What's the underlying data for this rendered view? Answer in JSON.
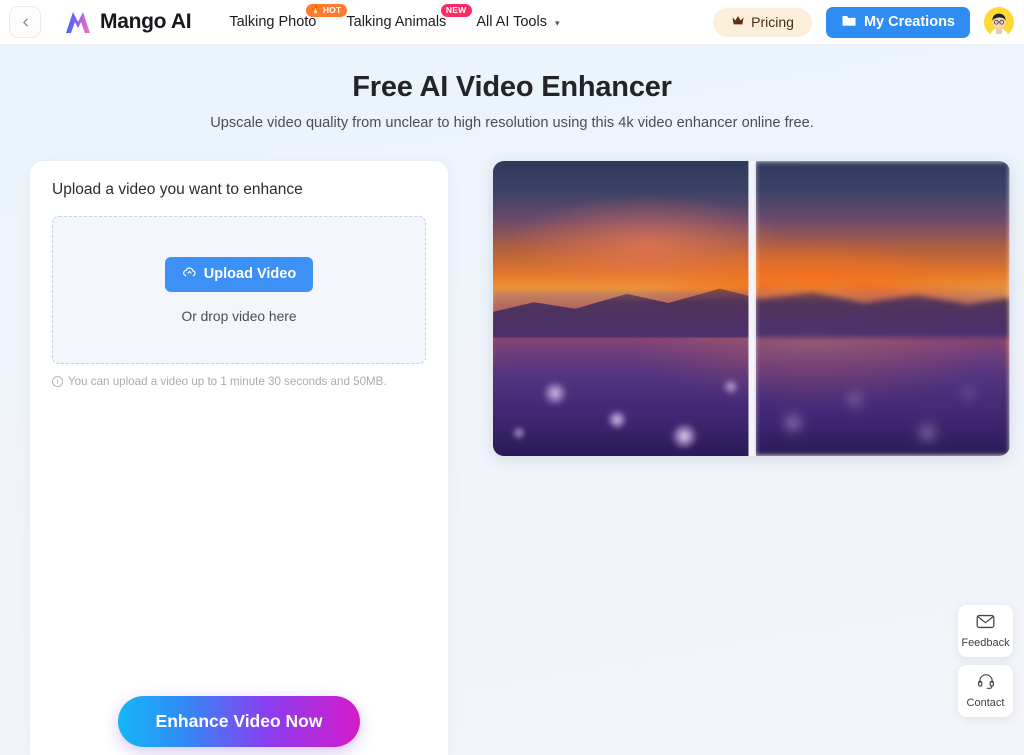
{
  "header": {
    "back_icon": "chevron-left-icon",
    "brand": {
      "logo_icon": "mango-ai-logo-icon",
      "name": "Mango AI"
    },
    "nav": [
      {
        "label": "Talking Photo",
        "badge": "HOT",
        "badge_type": "hot",
        "badge_icon": "flame-icon"
      },
      {
        "label": "Talking Animals",
        "badge": "NEW",
        "badge_type": "new"
      },
      {
        "label": "All AI Tools",
        "caret": "▾"
      }
    ],
    "pricing": {
      "label": "Pricing",
      "icon": "crown-icon"
    },
    "creations": {
      "label": "My Creations",
      "icon": "folder-icon"
    },
    "avatar_icon": "user-avatar"
  },
  "hero": {
    "title": "Free AI Video Enhancer",
    "subtitle": "Upscale video quality from unclear to high resolution using this 4k video enhancer online free."
  },
  "upload": {
    "card_title": "Upload a video you want to enhance",
    "button_label": "Upload Video",
    "button_icon": "cloud-upload-icon",
    "drop_text": "Or drop video here",
    "hint": "You can upload a video up to 1 minute 30 seconds and 50MB.",
    "hint_icon": "info-icon"
  },
  "cta": {
    "label": "Enhance Video Now"
  },
  "preview": {
    "name": "before-after-video-preview",
    "alt": "Blurred sunset over a field of purple flowers, split comparison"
  },
  "widgets": [
    {
      "label": "Feedback",
      "icon": "envelope-icon"
    },
    {
      "label": "Contact",
      "icon": "headset-icon"
    }
  ],
  "colors": {
    "primary_blue": "#3d90f5",
    "creations_blue": "#2f8cf2",
    "pricing_bg": "#fbeedb",
    "badge_hot": "#ff7a2f",
    "badge_new": "#fb2c63",
    "cta_gradient_start": "#14b7f5",
    "cta_gradient_end": "#d41bc8"
  }
}
